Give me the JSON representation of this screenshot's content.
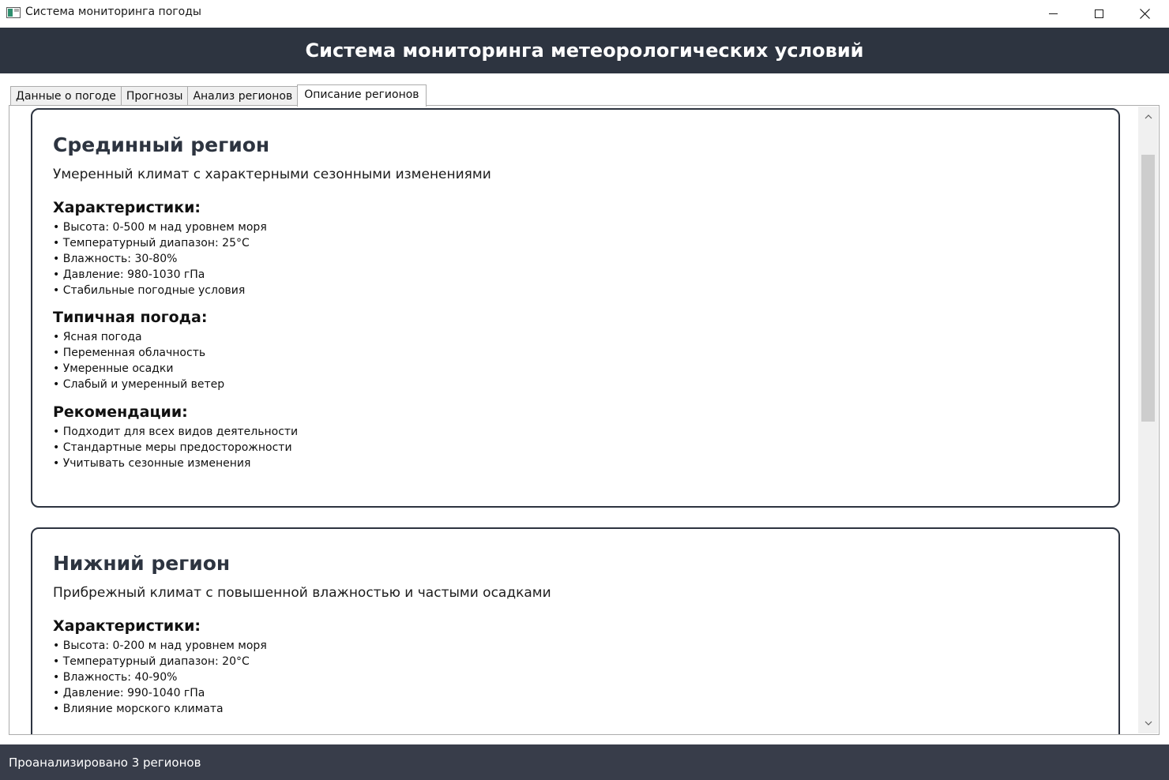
{
  "window": {
    "title": "Система мониторинга погоды",
    "controls": {
      "minimize": "minimize-icon",
      "maximize": "maximize-icon",
      "close": "close-icon"
    }
  },
  "header": {
    "title": "Система мониторинга метеорологических условий"
  },
  "tabs": [
    {
      "label": "Данные о погоде",
      "active": false
    },
    {
      "label": "Прогнозы",
      "active": false
    },
    {
      "label": "Анализ регионов",
      "active": false
    },
    {
      "label": "Описание регионов",
      "active": true
    }
  ],
  "regions": [
    {
      "name": "Срединный регион",
      "description": "Умеренный климат с характерными сезонными изменениями",
      "characteristics_title": "Характеристики:",
      "characteristics": [
        "• Высота: 0-500 м над уровнем моря",
        "• Температурный диапазон: 25°C",
        "• Влажность: 30-80%",
        "• Давление: 980-1030 гПа",
        "• Стабильные погодные условия"
      ],
      "weather_title": "Типичная погода:",
      "weather": [
        "• Ясная погода",
        "• Переменная облачность",
        "• Умеренные осадки",
        "• Слабый и умеренный ветер"
      ],
      "recommendations_title": "Рекомендации:",
      "recommendations": [
        "• Подходит для всех видов деятельности",
        "• Стандартные меры предосторожности",
        "• Учитывать сезонные изменения"
      ]
    },
    {
      "name": "Нижний регион",
      "description": "Прибрежный климат с повышенной влажностью и частыми осадками",
      "characteristics_title": "Характеристики:",
      "characteristics": [
        "• Высота: 0-200 м над уровнем моря",
        "• Температурный диапазон: 20°C",
        "• Влажность: 40-90%",
        "• Давление: 990-1040 гПа",
        "• Влияние морского климата"
      ]
    }
  ],
  "status": {
    "text": "Проанализировано 3 регионов"
  },
  "colors": {
    "header_bg": "#2d3440",
    "status_bg": "#383d4a",
    "card_border": "#2d3440"
  }
}
